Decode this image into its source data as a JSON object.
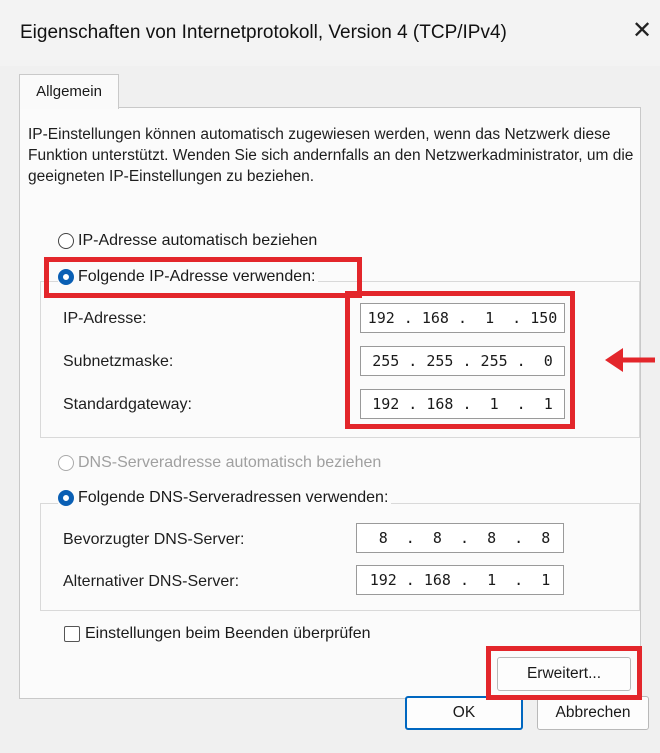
{
  "window": {
    "title": "Eigenschaften von Internetprotokoll, Version 4 (TCP/IPv4)",
    "close_glyph": "✕"
  },
  "tabs": [
    {
      "label": "Allgemein"
    }
  ],
  "description": "IP-Einstellungen können automatisch zugewiesen werden, wenn das Netzwerk diese Funktion unterstützt. Wenden Sie sich andernfalls an den Netzwerkadministrator, um die geeigneten IP-Einstellungen zu beziehen.",
  "ip_section": {
    "auto_label": "IP-Adresse automatisch beziehen",
    "manual_label": "Folgende IP-Adresse verwenden:",
    "selected": "manual",
    "fields": [
      {
        "label": "IP-Adresse:",
        "value": "192 . 168 .  1  . 150"
      },
      {
        "label": "Subnetzmaske:",
        "value": "255 . 255 . 255 .  0"
      },
      {
        "label": "Standardgateway:",
        "value": "192 . 168 .  1  .  1"
      }
    ]
  },
  "dns_section": {
    "auto_label": "DNS-Serveradresse automatisch beziehen",
    "auto_disabled": true,
    "manual_label": "Folgende DNS-Serveradressen verwenden:",
    "selected": "manual",
    "fields": [
      {
        "label": "Bevorzugter DNS-Server:",
        "value": " 8  .  8  .  8  .  8"
      },
      {
        "label": "Alternativer DNS-Server:",
        "value": "192 . 168 .  1  .  1"
      }
    ]
  },
  "validate_checkbox": {
    "label": "Einstellungen beim Beenden überprüfen",
    "checked": false
  },
  "buttons": {
    "advanced": "Erweitert...",
    "ok": "OK",
    "cancel": "Abbrechen"
  },
  "colors": {
    "highlight": "#e3262b",
    "accent": "#0a5fb4",
    "background": "#f0f0f0"
  }
}
